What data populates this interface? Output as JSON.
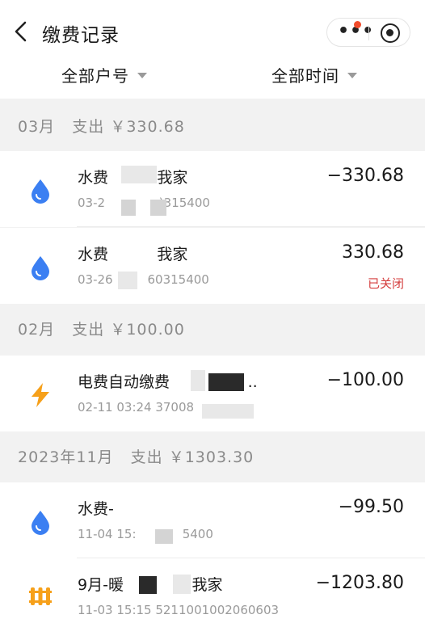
{
  "header": {
    "title": "缴费记录"
  },
  "filters": {
    "account": "全部户号",
    "time": "全部时间"
  },
  "sections": [
    {
      "heading": "03月   支出 ￥330.68"
    },
    {
      "heading": "02月   支出 ￥100.00"
    },
    {
      "heading": "2023年11月   支出 ￥1303.30"
    }
  ],
  "records": [
    {
      "name": "水费          我家",
      "sub": "03-2              )315400",
      "amount": "−330.68",
      "status": "",
      "icon": "water-drop-icon"
    },
    {
      "name": "水费          我家",
      "sub": "03-26         60315400",
      "amount": "330.68",
      "status": "已关闭",
      "icon": "water-drop-icon"
    },
    {
      "name": "电费自动缴费                ..",
      "sub": "02-11 03:24 37008",
      "amount": "−100.00",
      "status": "",
      "icon": "lightning-icon"
    },
    {
      "name": "水费-",
      "sub": "11-04 15:            5400",
      "amount": "−99.50",
      "status": "",
      "icon": "water-drop-icon"
    },
    {
      "name": "9月-暖              我家",
      "sub": "11-03 15:15 5211001002060603",
      "amount": "−1203.80",
      "status": "",
      "icon": "heating-icon"
    }
  ],
  "colors": {
    "water": "#3b7ff2",
    "electric": "#f6a01a",
    "heating": "#f6a01a",
    "closed_status": "#d43c3c"
  }
}
